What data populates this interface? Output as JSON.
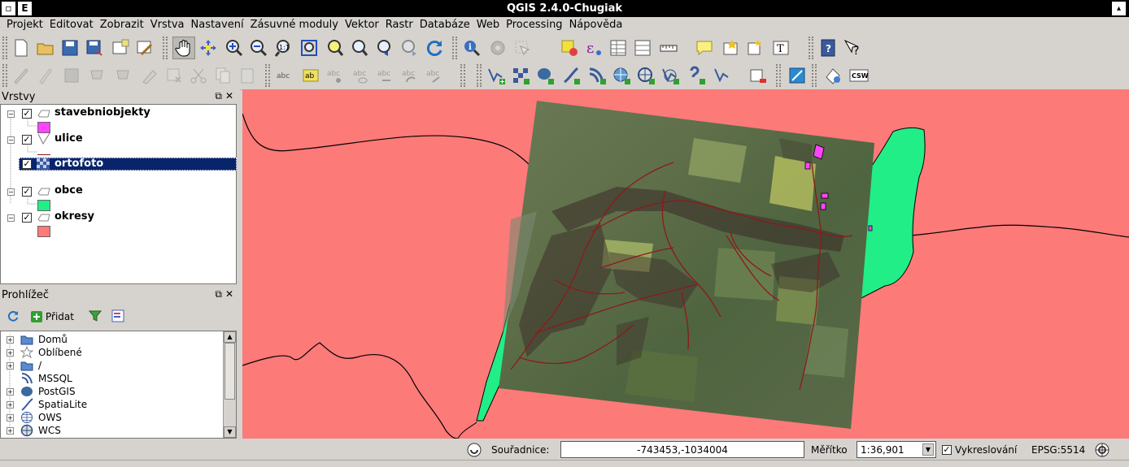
{
  "window": {
    "title": "QGIS 2.4.0-Chugiak",
    "menu_icon": "E"
  },
  "menubar": [
    "Projekt",
    "Editovat",
    "Zobrazit",
    "Vrstva",
    "Nastavení",
    "Zásuvné moduly",
    "Vektor",
    "Rastr",
    "Databáze",
    "Web",
    "Processing",
    "Nápověda"
  ],
  "layers_panel": {
    "title": "Vrstvy",
    "layers": [
      {
        "name": "stavebniobjekty",
        "visible": true,
        "type": "polygon",
        "color": "#ff44ff"
      },
      {
        "name": "ulice",
        "visible": true,
        "type": "line",
        "color": "#8b1a1a"
      },
      {
        "name": "ortofoto",
        "visible": true,
        "type": "raster",
        "selected": true
      },
      {
        "name": "obce",
        "visible": true,
        "type": "polygon",
        "color": "#22ee88"
      },
      {
        "name": "okresy",
        "visible": true,
        "type": "polygon",
        "color": "#fc7a78"
      }
    ]
  },
  "browser_panel": {
    "title": "Prohlížeč",
    "add_label": "Přidat",
    "items": [
      {
        "label": "Domů",
        "icon": "folder-icon"
      },
      {
        "label": "Oblíbené",
        "icon": "star-icon"
      },
      {
        "label": "/",
        "icon": "folder-icon"
      },
      {
        "label": "MSSQL",
        "icon": "mssql-icon"
      },
      {
        "label": "PostGIS",
        "icon": "postgis-icon"
      },
      {
        "label": "SpatiaLite",
        "icon": "spatialite-icon"
      },
      {
        "label": "OWS",
        "icon": "globe-icon"
      },
      {
        "label": "WCS",
        "icon": "globe-icon"
      }
    ]
  },
  "statusbar": {
    "coord_label": "Souřadnice:",
    "coordinates": "-743453,-1034004",
    "scale_label": "Měřítko",
    "scale_value": "1:36,901",
    "render_label": "Vykreslování",
    "render_checked": true,
    "crs": "EPSG:5514"
  },
  "colors": {
    "okresy": "#fc7a78",
    "obce": "#22ee88",
    "buildings": "#ff44ff",
    "streets": "#8b1a1a"
  },
  "toolbar2": {
    "csw_label": "CSW"
  }
}
